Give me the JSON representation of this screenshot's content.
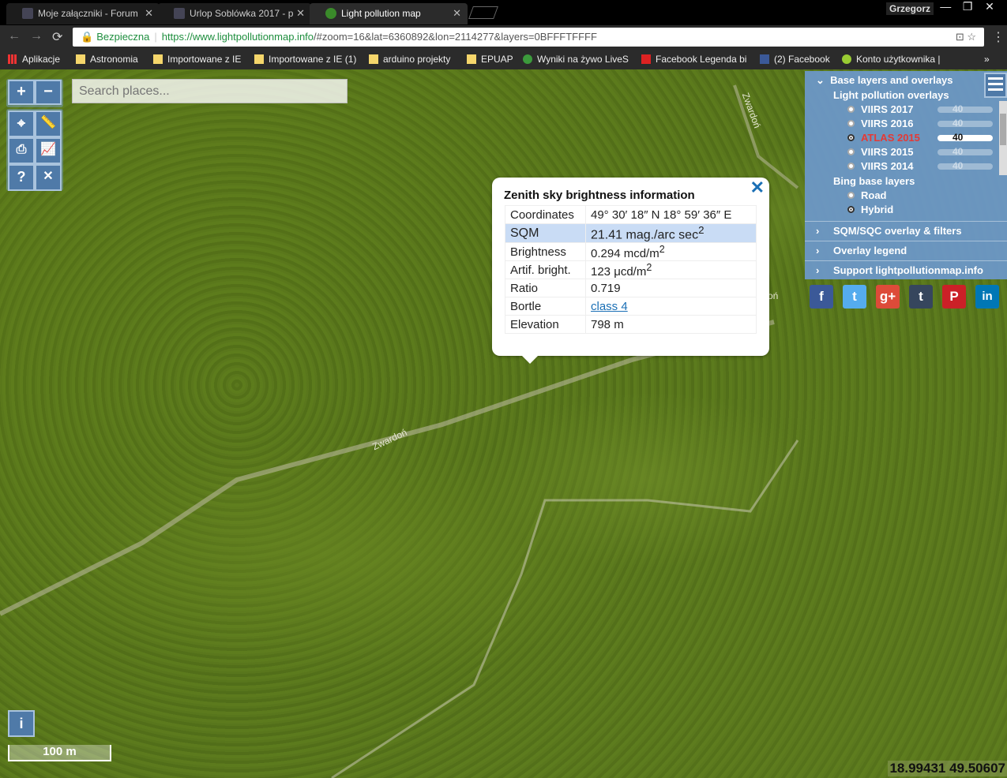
{
  "tabs": [
    {
      "label": "Moje załączniki - Forum"
    },
    {
      "label": "Urlop Soblówka 2017 - p"
    },
    {
      "label": "Light pollution map"
    }
  ],
  "window": {
    "user": "Grzegorz",
    "min": "—",
    "max": "❐",
    "close": "✕"
  },
  "address": {
    "secure_label": "Bezpieczna",
    "url_scheme_host": "https://www.lightpollutionmap.info",
    "url_rest": "/#zoom=16&lat=6360892&lon=2114277&layers=0BFFFTFFFF"
  },
  "bookmarks": [
    {
      "label": "Aplikacje"
    },
    {
      "label": "Astronomia"
    },
    {
      "label": "Importowane z IE"
    },
    {
      "label": "Importowane z IE (1)"
    },
    {
      "label": "arduino projekty"
    },
    {
      "label": "EPUAP"
    },
    {
      "label": "Wyniki na żywo LiveS"
    },
    {
      "label": "Facebook Legenda bi"
    },
    {
      "label": "(2) Facebook"
    },
    {
      "label": "Konto użytkownika |"
    },
    {
      "label": "»"
    }
  ],
  "map": {
    "search_placeholder": "Search places...",
    "zoom_in": "+",
    "zoom_out": "−",
    "help": "?",
    "info": "i",
    "scale": "100 m",
    "coords": "18.99431 49.50607",
    "road_labels": [
      "Zwardoń",
      "Zwardoń",
      "oń"
    ]
  },
  "popup": {
    "title": "Zenith sky brightness information",
    "close": "✕",
    "rows": [
      {
        "label": "Coordinates",
        "value": "49° 30′ 18″ N 18° 59′ 36″ E",
        "sup": ""
      },
      {
        "label": "SQM",
        "value": "21.41 mag./arc sec",
        "sup": "2"
      },
      {
        "label": "Brightness",
        "value": "0.294 mcd/m",
        "sup": "2"
      },
      {
        "label": "Artif. bright.",
        "value": "123 μcd/m",
        "sup": "2"
      },
      {
        "label": "Ratio",
        "value": "0.719",
        "sup": ""
      },
      {
        "label": "Bortle",
        "value": "class 4",
        "sup": ""
      },
      {
        "label": "Elevation",
        "value": "798 m",
        "sup": ""
      }
    ]
  },
  "layers": {
    "base_header": "Base layers and overlays",
    "lp_header": "Light pollution overlays",
    "lp": [
      {
        "label": "VIIRS 2017",
        "opacity": "40"
      },
      {
        "label": "VIIRS 2016",
        "opacity": "40"
      },
      {
        "label": "ATLAS 2015",
        "opacity": "40"
      },
      {
        "label": "VIIRS 2015",
        "opacity": "40"
      },
      {
        "label": "VIIRS 2014",
        "opacity": "40"
      }
    ],
    "bing_header": "Bing base layers",
    "bing": [
      {
        "label": "Road"
      },
      {
        "label": "Hybrid"
      }
    ],
    "sqm_header": "SQM/SQC overlay & filters",
    "legend_header": "Overlay legend",
    "support_header": "Support lightpollutionmap.info"
  },
  "social": [
    {
      "label": "f",
      "color": "#3b5998"
    },
    {
      "label": "t",
      "color": "#55acee"
    },
    {
      "label": "g+",
      "color": "#dd4b39"
    },
    {
      "label": "t",
      "color": "#36465d"
    },
    {
      "label": "P",
      "color": "#cb2027"
    },
    {
      "label": "in",
      "color": "#0077b5"
    }
  ],
  "colors": {
    "accent": "#4f7aa8",
    "active_layer": "#e53935",
    "secure": "#1e8e3e"
  }
}
